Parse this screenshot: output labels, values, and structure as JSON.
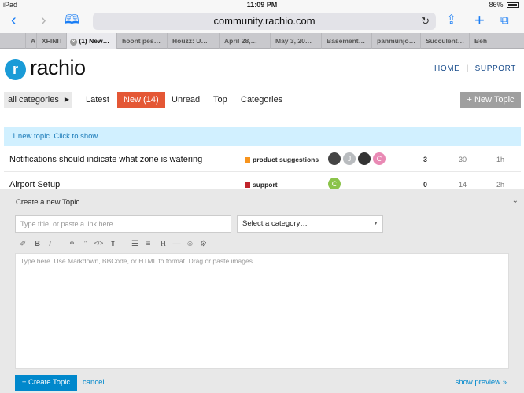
{
  "status_bar": {
    "device": "iPad",
    "wifi": "wifi-icon",
    "time": "11:09 PM",
    "battery_percent": "86%"
  },
  "browser": {
    "url": "community.rachio.com",
    "tabs": [
      {
        "label": "A"
      },
      {
        "label": "XFINIT"
      },
      {
        "label": "(1) New…"
      },
      {
        "label": "hoont pes…"
      },
      {
        "label": "Houzz: U…"
      },
      {
        "label": "April 28,…"
      },
      {
        "label": "May 3, 20…"
      },
      {
        "label": "Basement…"
      },
      {
        "label": "panmunjo…"
      },
      {
        "label": "Succulent…"
      },
      {
        "label": "Beh"
      }
    ]
  },
  "site": {
    "logo_letter": "r",
    "logo_text": "rachio",
    "home": "HOME",
    "separator": "|",
    "support": "SUPPORT"
  },
  "nav": {
    "categories_dropdown": "all categories",
    "latest": "Latest",
    "new": "New (14)",
    "unread": "Unread",
    "top": "Top",
    "categories": "Categories",
    "new_topic_button": "+ New Topic"
  },
  "banner": "1 new topic. Click to show.",
  "topics": [
    {
      "title": "Notifications should indicate what zone is watering",
      "category": "product suggestions",
      "category_color": "#f7941d",
      "avatars": [
        {
          "letter": "",
          "color": "#444"
        },
        {
          "letter": "J",
          "color": "#b9bcbf"
        },
        {
          "letter": "",
          "color": "#333"
        },
        {
          "letter": "C",
          "color": "#e989b4"
        }
      ],
      "replies": "3",
      "views": "30",
      "activity": "1h"
    },
    {
      "title": "Airport Setup",
      "category": "support",
      "category_color": "#c0242b",
      "avatars": [
        {
          "letter": "C",
          "color": "#8bc34a"
        }
      ],
      "replies": "0",
      "views": "14",
      "activity": "2h"
    }
  ],
  "composer": {
    "heading": "Create a new Topic",
    "title_placeholder": "Type title, or paste a link here",
    "category_select": "Select a category…",
    "editor_placeholder": "Type here. Use Markdown, BBCode, or HTML to format. Drag or paste images.",
    "create_button": "+ Create Topic",
    "cancel": "cancel",
    "show_preview": "show preview »",
    "toolbar": [
      "quote-icon",
      "bold-icon",
      "italic-icon",
      "link-icon",
      "blockquote-icon",
      "code-icon",
      "upload-icon",
      "bullet-list-icon",
      "numbered-list-icon",
      "heading-icon",
      "rule-icon",
      "emoji-icon",
      "options-icon"
    ]
  }
}
